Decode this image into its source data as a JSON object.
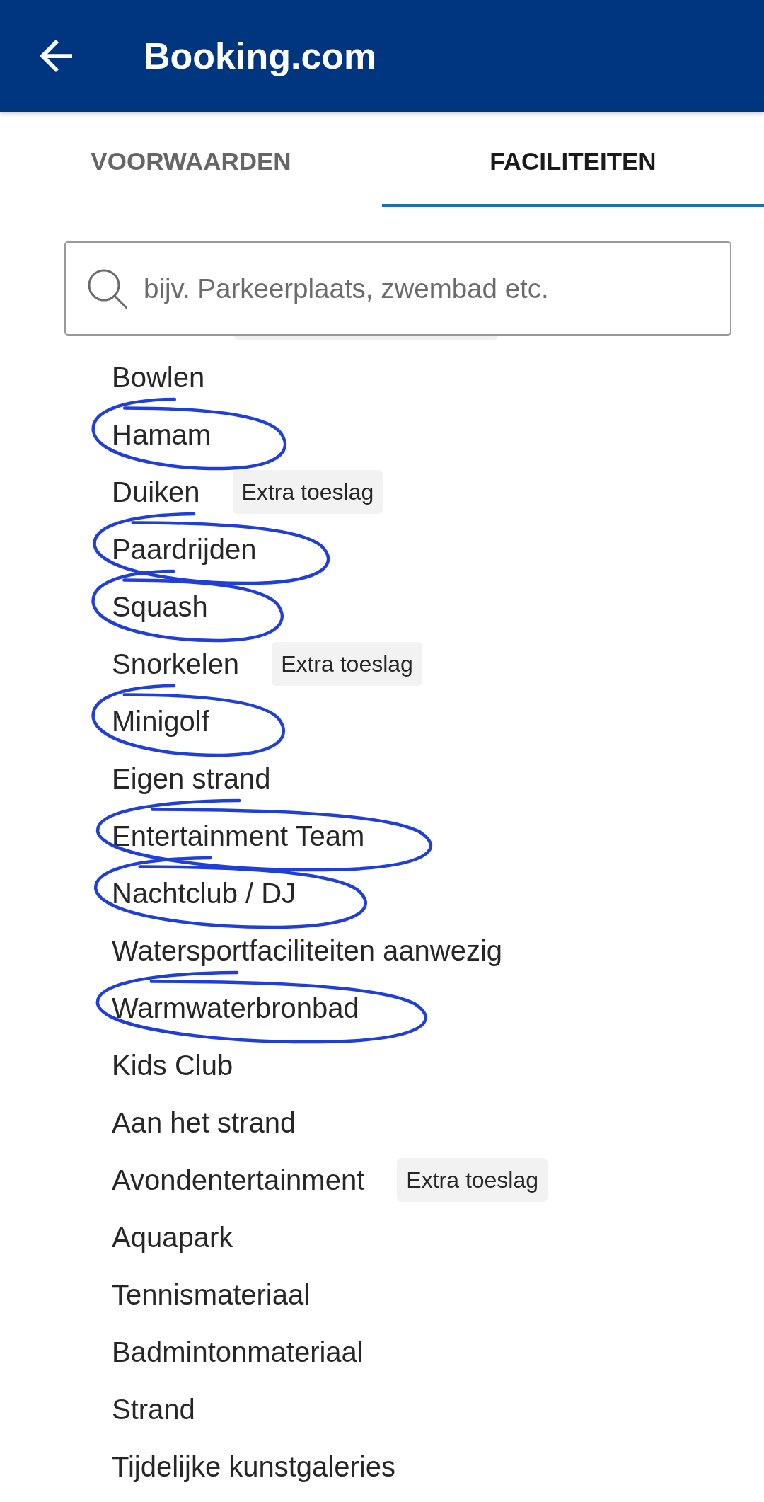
{
  "app_bar": {
    "title": "Booking.com"
  },
  "tabs": [
    {
      "label": "VOORWAARDEN",
      "selected": false
    },
    {
      "label": "FACILITEITEN",
      "selected": true
    }
  ],
  "search": {
    "placeholder": "bijv. Parkeerplaats, zwembad etc."
  },
  "facilities": [
    {
      "name": "Bowlen",
      "circled": false
    },
    {
      "name": "Hamam",
      "circled": true
    },
    {
      "name": "Duiken",
      "circled": false,
      "tag": "Extra toeslag"
    },
    {
      "name": "Paardrijden",
      "circled": true
    },
    {
      "name": "Squash",
      "circled": true
    },
    {
      "name": "Snorkelen",
      "circled": false,
      "tag": "Extra toeslag"
    },
    {
      "name": "Minigolf",
      "circled": true
    },
    {
      "name": "Eigen strand",
      "circled": false
    },
    {
      "name": "Entertainment Team",
      "circled": true
    },
    {
      "name": "Nachtclub / DJ",
      "circled": true
    },
    {
      "name": "Watersportfaciliteiten aanwezig",
      "circled": false
    },
    {
      "name": "Warmwaterbronbad",
      "circled": true
    },
    {
      "name": "Kids Club",
      "circled": false
    },
    {
      "name": "Aan het strand",
      "circled": false
    },
    {
      "name": "Avondentertainment",
      "circled": false,
      "tag": "Extra toeslag"
    },
    {
      "name": "Aquapark",
      "circled": false
    },
    {
      "name": "Tennismateriaal",
      "circled": false
    },
    {
      "name": "Badmintonmateriaal",
      "circled": false
    },
    {
      "name": "Strand",
      "circled": false
    },
    {
      "name": "Tijdelijke kunstgaleries",
      "circled": false
    }
  ]
}
